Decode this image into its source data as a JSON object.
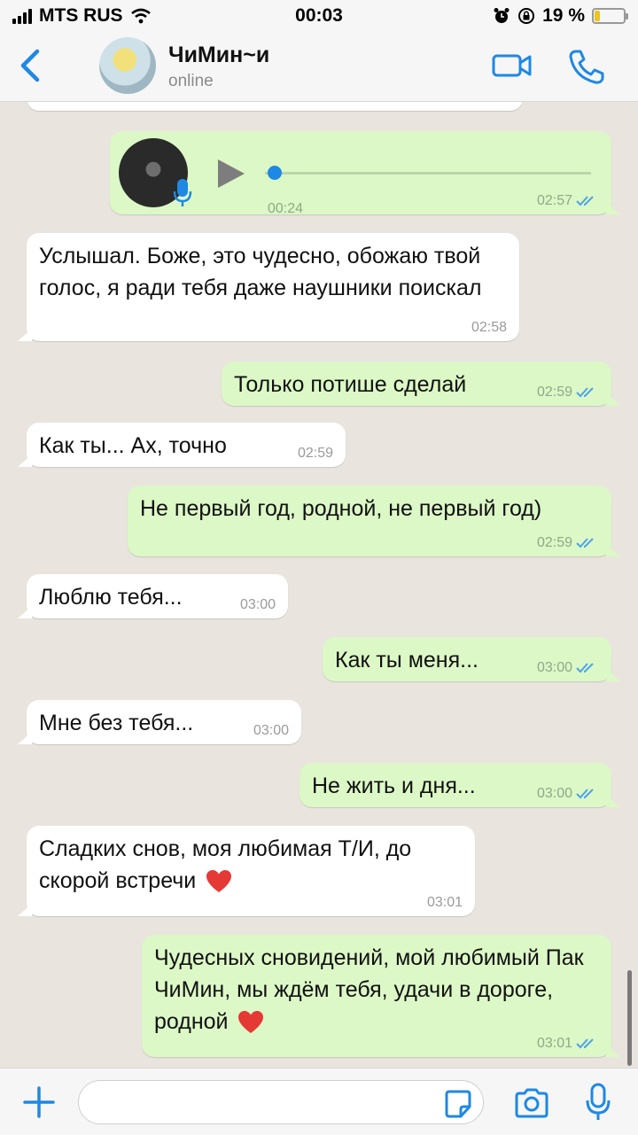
{
  "status_bar": {
    "carrier": "MTS RUS",
    "time": "00:03",
    "battery_percent": "19 %",
    "battery_level": 0.19,
    "icons": [
      "signal-icon",
      "wifi-icon",
      "alarm-icon",
      "orientation-lock-icon",
      "battery-icon"
    ]
  },
  "header": {
    "contact_name": "ЧиМин~и",
    "contact_status": "online",
    "icons": [
      "back-chevron-icon",
      "video-call-icon",
      "phone-call-icon"
    ]
  },
  "messages": [
    {
      "dir": "out",
      "type": "voice",
      "duration": "00:24",
      "time": "02:57",
      "progress": 0.0
    },
    {
      "dir": "in",
      "text": "Услышал. Боже, это чудесно, обожаю твой голос, я ради тебя даже наушники поискал",
      "time": "02:58"
    },
    {
      "dir": "out",
      "text": "Только потише сделай",
      "time": "02:59"
    },
    {
      "dir": "in",
      "text": "Как ты... Ах, точно",
      "time": "02:59"
    },
    {
      "dir": "out",
      "text": "Не первый год, родной, не первый год)",
      "time": "02:59"
    },
    {
      "dir": "in",
      "text": "Люблю тебя...",
      "time": "03:00"
    },
    {
      "dir": "out",
      "text": "Как ты меня...",
      "time": "03:00"
    },
    {
      "dir": "in",
      "text": "Мне без тебя...",
      "time": "03:00"
    },
    {
      "dir": "out",
      "text": "Не жить и дня...",
      "time": "03:00"
    },
    {
      "dir": "in",
      "text": "Сладких снов, моя любимая Т/И, до скорой встречи",
      "emoji": "heart-icon",
      "time": "03:01"
    },
    {
      "dir": "out",
      "text": "Чудесных сновидений, мой любимый Пак ЧиМин, мы ждём тебя, удачи в дороге, родной",
      "emoji": "heart-icon",
      "time": "03:01"
    }
  ],
  "input_bar": {
    "placeholder": "",
    "value": "",
    "icons": [
      "plus-icon",
      "sticker-icon",
      "camera-icon",
      "microphone-icon"
    ]
  },
  "colors": {
    "background": "#e9e5de",
    "incoming_bubble": "#ffffff",
    "outgoing_bubble": "#dcf8c6",
    "accent": "#1e88e5",
    "read_ticks": "#4fa3e8",
    "heart": "#e53935"
  }
}
